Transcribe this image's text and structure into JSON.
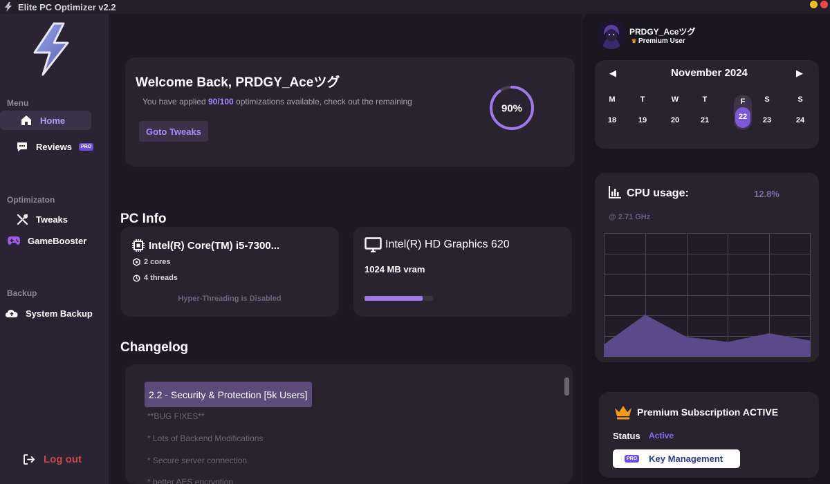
{
  "window": {
    "title": "Elite PC Optimizer v2.2",
    "colors": {
      "minimize": "#f0c020",
      "close": "#f04848",
      "accent": "#a78bfa"
    }
  },
  "sidebar": {
    "sections": {
      "menu": "Menu",
      "optimization": "Optimizaton",
      "backup": "Backup"
    },
    "items": {
      "home": {
        "label": "Home",
        "icon": "home-icon"
      },
      "reviews": {
        "label": "Reviews",
        "icon": "chat-icon",
        "badge": "PRO"
      },
      "tweaks": {
        "label": "Tweaks",
        "icon": "wrench-icon"
      },
      "gamebooster": {
        "label": "GameBooster",
        "icon": "gamepad-icon"
      },
      "system_backup": {
        "label": "System Backup",
        "icon": "cloud-upload-icon"
      }
    },
    "logout": "Log out"
  },
  "welcome": {
    "title": "Welcome Back, PRDGY_Aceツグ",
    "sub_prefix": "You have applied ",
    "sub_count": "90/100",
    "sub_suffix": " optimizations available, check out the remaining",
    "button": "Goto Tweaks",
    "progress_label": "90%",
    "progress_value": 0.9
  },
  "pc_info": {
    "heading": "PC Info",
    "cpu": {
      "name": "Intel(R) Core(TM) i5-7300...",
      "cores": "2 cores",
      "threads": "4 threads",
      "note": "Hyper-Threading is Disabled"
    },
    "gpu": {
      "name": "Intel(R) HD Graphics 620",
      "vram": "1024 MB vram",
      "usage_fraction": 0.85
    }
  },
  "changelog": {
    "heading": "Changelog",
    "entry_title": "2.2 - Security & Protection [5k Users]",
    "lines": [
      "**BUG FIXES**",
      "* Lots of Backend Modifications",
      "* Secure server connection",
      "* better AES encryption"
    ]
  },
  "user": {
    "name": "PRDGY_Aceツグ",
    "role": "Premium User",
    "avatar": "avatar-icon"
  },
  "calendar": {
    "month": "November 2024",
    "prev": "◀",
    "next": "▶",
    "days": [
      {
        "dow": "M",
        "date": "18"
      },
      {
        "dow": "T",
        "date": "19"
      },
      {
        "dow": "W",
        "date": "20"
      },
      {
        "dow": "T",
        "date": "21"
      },
      {
        "dow": "F",
        "date": "22"
      },
      {
        "dow": "S",
        "date": "23"
      },
      {
        "dow": "S",
        "date": "24"
      }
    ],
    "selected_index": 4
  },
  "cpu_usage": {
    "title": "CPU usage:",
    "value": "12.8%",
    "freq": "@ 2.71 GHz",
    "history": [
      10,
      34,
      16,
      12,
      19,
      13
    ]
  },
  "premium": {
    "title": "Premium Subscription ACTIVE",
    "status_label": "Status",
    "status_value": "Active",
    "key_button": "Key Management",
    "badge": "PRO"
  }
}
